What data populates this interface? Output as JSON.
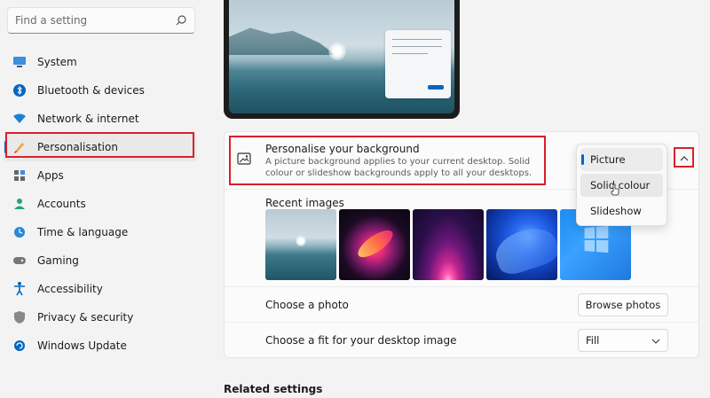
{
  "search": {
    "placeholder": "Find a setting"
  },
  "sidebar": {
    "items": [
      {
        "label": "System",
        "icon": "monitor-icon",
        "color": "#0067c0"
      },
      {
        "label": "Bluetooth & devices",
        "icon": "bluetooth-icon",
        "color": "#0067c0"
      },
      {
        "label": "Network & internet",
        "icon": "wifi-icon",
        "color": "#0078d4"
      },
      {
        "label": "Personalisation",
        "icon": "paintbrush-icon",
        "color": "#e07a2c",
        "active": true
      },
      {
        "label": "Apps",
        "icon": "apps-icon",
        "color": "#555555"
      },
      {
        "label": "Accounts",
        "icon": "person-icon",
        "color": "#1ea670"
      },
      {
        "label": "Time & language",
        "icon": "globe-clock-icon",
        "color": "#0078d4"
      },
      {
        "label": "Gaming",
        "icon": "gamepad-icon",
        "color": "#6b6b6b"
      },
      {
        "label": "Accessibility",
        "icon": "accessibility-icon",
        "color": "#0067c0"
      },
      {
        "label": "Privacy & security",
        "icon": "shield-icon",
        "color": "#6b6b6b"
      },
      {
        "label": "Windows Update",
        "icon": "update-icon",
        "color": "#0067c0"
      }
    ]
  },
  "background": {
    "title": "Personalise your background",
    "description": "A picture background applies to your current desktop. Solid colour or slideshow backgrounds apply to all your desktops.",
    "dropdown": {
      "options": [
        "Picture",
        "Solid colour",
        "Slideshow"
      ],
      "selected": "Picture",
      "hovered": "Solid colour"
    }
  },
  "recent": {
    "title": "Recent images"
  },
  "choose_photo": {
    "label": "Choose a photo",
    "button": "Browse photos"
  },
  "choose_fit": {
    "label": "Choose a fit for your desktop image",
    "value": "Fill"
  },
  "related": {
    "title": "Related settings"
  },
  "colors": {
    "accent": "#0067c0",
    "highlight_red": "#d8202b"
  }
}
